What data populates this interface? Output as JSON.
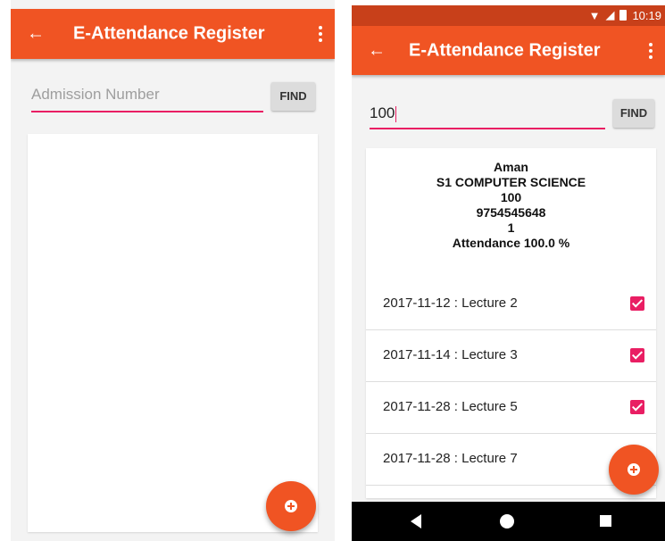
{
  "left_screen": {
    "appbar": {
      "back_icon": "arrow-left-icon",
      "title": "E-Attendance Register",
      "menu_icon": "more-vert-icon"
    },
    "search": {
      "placeholder": "Admission Number",
      "value": "",
      "find_label": "FIND"
    },
    "fab_icon": "add-circle-icon"
  },
  "right_screen": {
    "status_bar": {
      "time": "10:19",
      "icons": [
        "wifi-icon",
        "signal-icon",
        "battery-icon"
      ]
    },
    "appbar": {
      "back_icon": "arrow-left-icon",
      "title": "E-Attendance Register",
      "menu_icon": "more-vert-icon"
    },
    "search": {
      "placeholder": "Admission Number",
      "value": "100",
      "find_label": "FIND"
    },
    "student": {
      "name": "Aman",
      "course": "S1 COMPUTER SCIENCE",
      "admission_number": "100",
      "phone": "9754545648",
      "roll": "1",
      "attendance": "Attendance 100.0 %"
    },
    "lectures": [
      {
        "label": "2017-11-12 : Lecture 2",
        "checked": true
      },
      {
        "label": "2017-11-14 : Lecture 3",
        "checked": true
      },
      {
        "label": "2017-11-28 : Lecture 5",
        "checked": true
      },
      {
        "label": "2017-11-28 : Lecture 7",
        "checked": true
      }
    ],
    "fab_icon": "add-circle-icon",
    "nav_icons": [
      "nav-back-icon",
      "nav-home-icon",
      "nav-recents-icon"
    ]
  },
  "colors": {
    "primary": "#f05423",
    "primary_dark": "#c8401a",
    "accent": "#e91e63"
  }
}
